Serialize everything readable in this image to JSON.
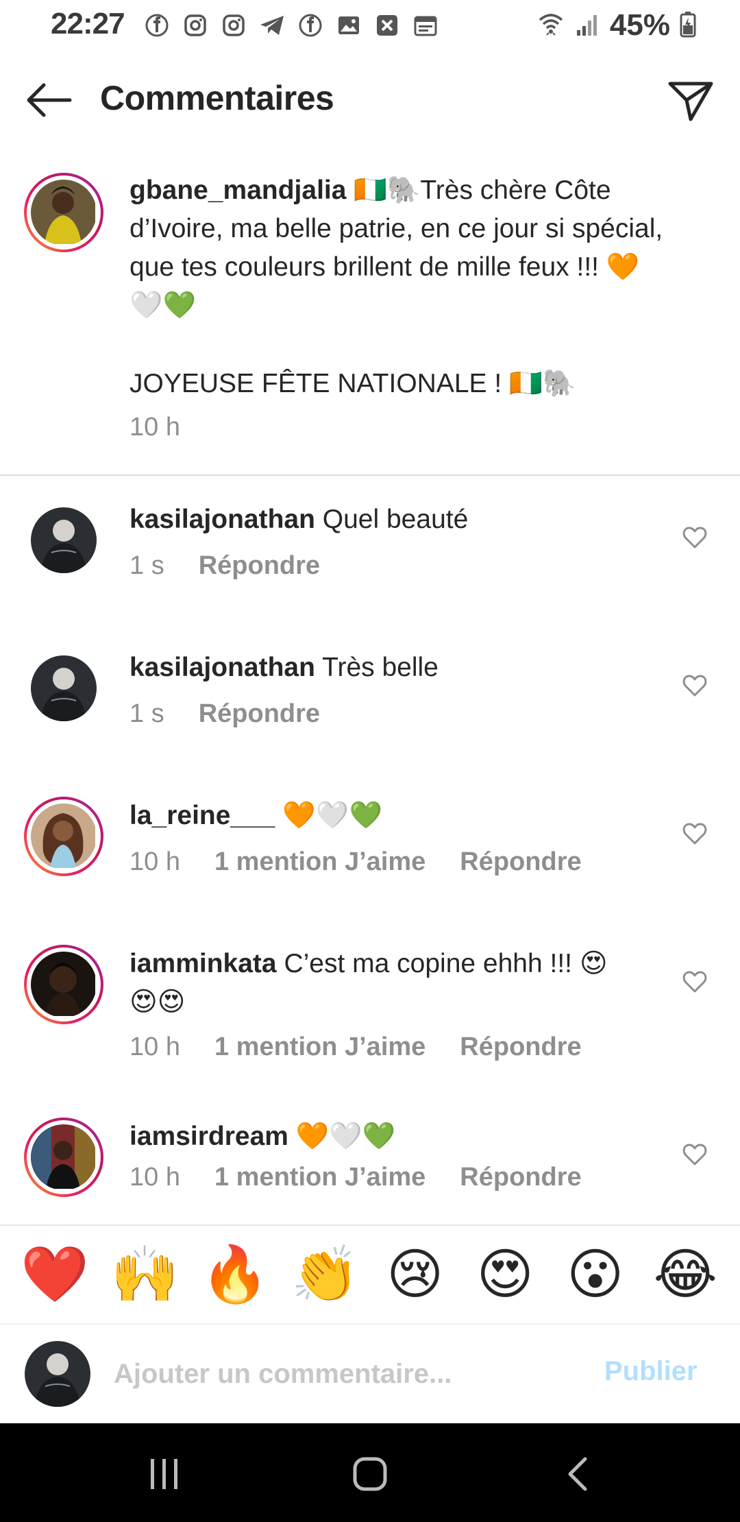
{
  "status_bar": {
    "time": "22:27",
    "battery": "45%",
    "notification_icons": [
      "facebook-icon",
      "instagram-icon",
      "instagram-icon",
      "telegram-icon",
      "facebook-icon",
      "gallery-icon",
      "x-icon",
      "calendar-icon"
    ]
  },
  "header": {
    "title": "Commentaires"
  },
  "caption": {
    "username": "gbane_mandjalia",
    "text": "🇨🇮🐘Très chère Côte d’Ivoire, ma belle patrie, en ce jour si spécial, que tes couleurs brillent de mille feux !!! 🧡🤍💚",
    "text2": "JOYEUSE FÊTE NATIONALE ! 🇨🇮🐘",
    "time": "10 h"
  },
  "comments": [
    {
      "username": "kasilajonathan",
      "text": "Quel beauté",
      "time": "1 s",
      "likes": "",
      "reply": "Répondre"
    },
    {
      "username": "kasilajonathan",
      "text": "Très belle",
      "time": "1 s",
      "likes": "",
      "reply": "Répondre"
    },
    {
      "username": "la_reine___",
      "text": "🧡🤍💚",
      "time": "10 h",
      "likes": "1 mention J’aime",
      "reply": "Répondre"
    },
    {
      "username": "iamminkata",
      "text": "C’est ma copine ehhh !!! 😍😍😍",
      "time": "10 h",
      "likes": "1 mention J’aime",
      "reply": "Répondre"
    },
    {
      "username": "iamsirdream",
      "text": "🧡🤍💚",
      "time": "10 h",
      "likes": "1 mention J’aime",
      "reply": "Répondre"
    }
  ],
  "emoji_bar": [
    "❤️",
    "🙌",
    "🔥",
    "👏",
    "😢",
    "😍",
    "😮",
    "😂"
  ],
  "input": {
    "placeholder": "Ajouter un commentaire...",
    "publish": "Publier"
  },
  "colors": {
    "text": "#262626",
    "secondary": "#8e8e8e",
    "publish_disabled": "#b2dffc",
    "divider": "#dbdbdb"
  }
}
